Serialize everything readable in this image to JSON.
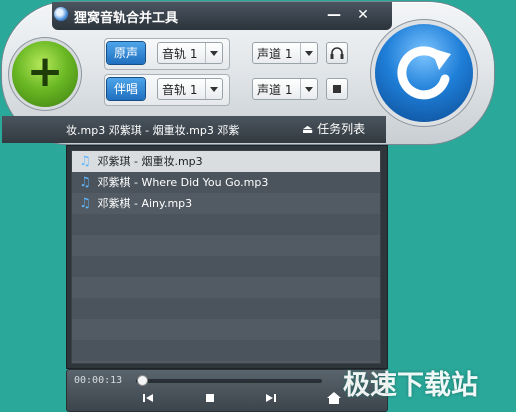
{
  "app": {
    "title": "狸窝音轨合并工具",
    "minimize_label": "—",
    "close_label": "✕"
  },
  "controls": {
    "row1": {
      "label": "原声",
      "track_value": "音轨 1",
      "channel_value": "声道 1"
    },
    "row2": {
      "label": "伴唱",
      "track_value": "音轨 1",
      "channel_value": "声道 1"
    }
  },
  "icons": {
    "add": "plus-icon",
    "start": "refresh-arrow-icon",
    "headphones": "headphones-icon",
    "stop": "stop-icon",
    "eject": "eject-icon",
    "music": "music-note-icon",
    "prev": "skip-back-icon",
    "next": "skip-forward-icon",
    "home": "home-icon"
  },
  "strip": {
    "scroll_text": "妆.mp3    邓紫琪 - 烟重妆.mp3    邓紫",
    "task_list_label": "任务列表"
  },
  "files": [
    "邓紫琪 - 烟重妆.mp3",
    "邓紫棋 - Where Did You Go.mp3",
    "邓紫棋 - Ainy.mp3"
  ],
  "player": {
    "time": "00:00:13",
    "progress": 0.02
  },
  "watermark": "极速下载站",
  "colors": {
    "background": "#2aa89a",
    "accent_blue": "#1f7fd8",
    "accent_green": "#6ab824"
  }
}
